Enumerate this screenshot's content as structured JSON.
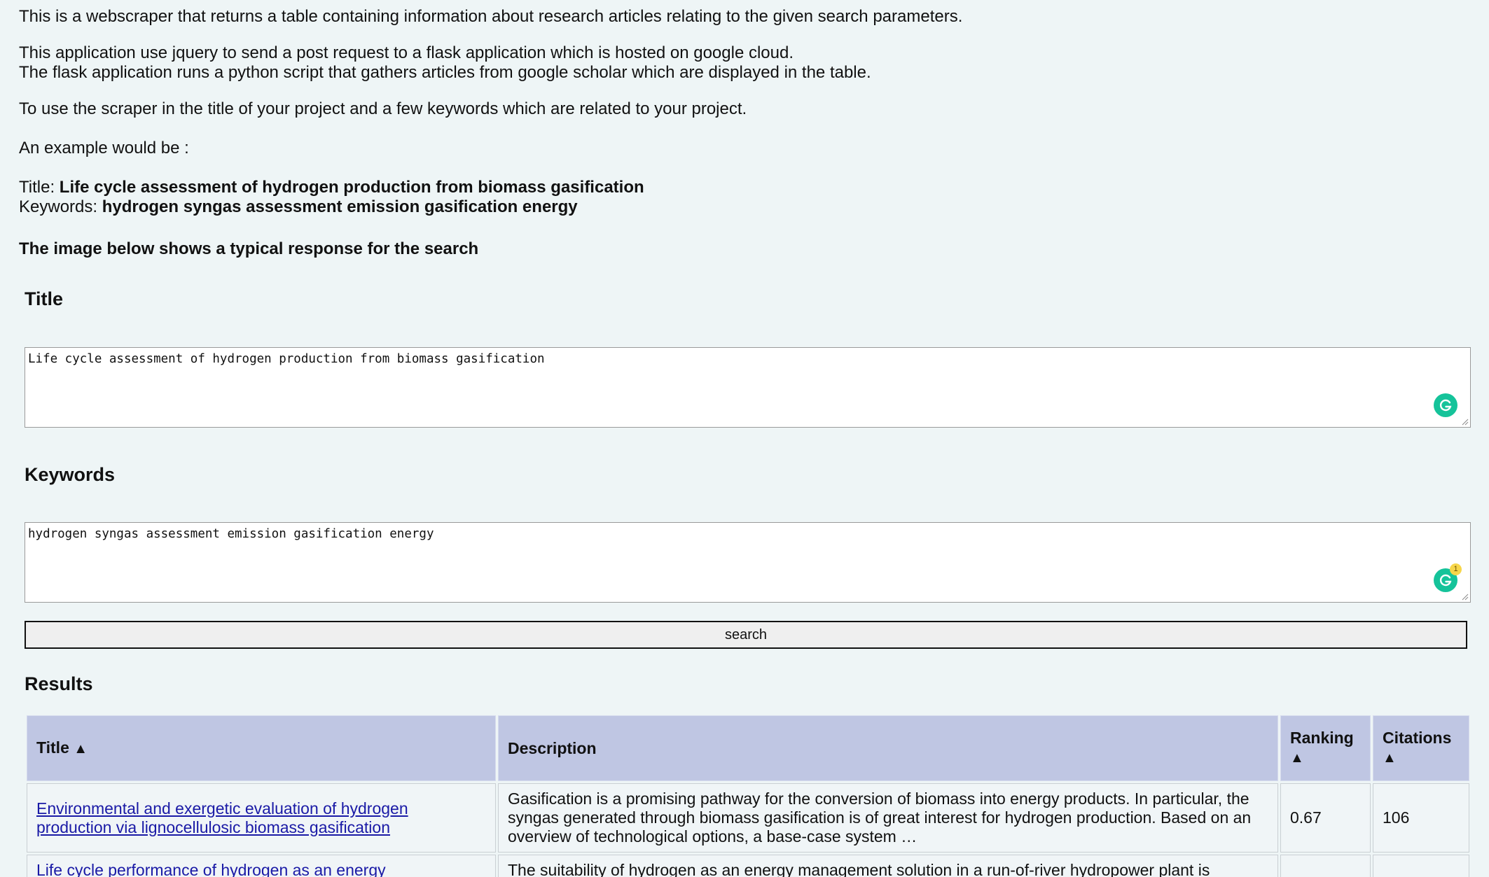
{
  "intro": {
    "line1": "This is a webscraper that returns a table containing information about research articles relating to the given search parameters.",
    "line2": "This application use jquery to send a post request to a flask application which is hosted on google cloud.",
    "line3": "The flask application runs a python script that gathers articles from google scholar which are displayed in the table.",
    "line4": "To use the scraper in the title of your project and a few keywords which are related to your project.",
    "line5": "An example would be :",
    "example_title_label": "Title: ",
    "example_title_value": "Life cycle assessment of hydrogen production from biomass gasification",
    "example_keywords_label": "Keywords: ",
    "example_keywords_value": "hydrogen syngas assessment emission gasification energy",
    "line6": "The image below shows a typical response for the search"
  },
  "form": {
    "title_heading": "Title",
    "title_value": "Life cycle assessment of hydrogen production from biomass gasification",
    "keywords_heading": "Keywords",
    "keywords_value": "hydrogen syngas assessment emission gasification energy",
    "keywords_grammarly_badge": "1",
    "search_button": "search"
  },
  "results": {
    "heading": "Results",
    "columns": {
      "title": "Title",
      "title_sort": "▲",
      "description": "Description",
      "ranking": "Ranking",
      "ranking_sort": "▲",
      "citations": "Citations",
      "citations_sort": "▲"
    },
    "rows": [
      {
        "title": "Environmental and exergetic evaluation of hydrogen production via lignocellulosic biomass gasification",
        "description": "Gasification is a promising pathway for the conversion of biomass into energy products. In particular, the syngas generated through biomass gasification is of great interest for hydrogen production. Based on an overview of technological options, a base-case system …",
        "ranking": "0.67",
        "citations": "106"
      },
      {
        "title": "Life cycle performance of hydrogen as an energy",
        "description": "The suitability of hydrogen as an energy management solution in a run-of-river hydropower plant is",
        "ranking": "",
        "citations": ""
      }
    ]
  },
  "colors": {
    "background": "#eef5f6",
    "table_header": "#bfc6e3",
    "link": "#1a1aa6",
    "grammarly": "#15c39a"
  }
}
